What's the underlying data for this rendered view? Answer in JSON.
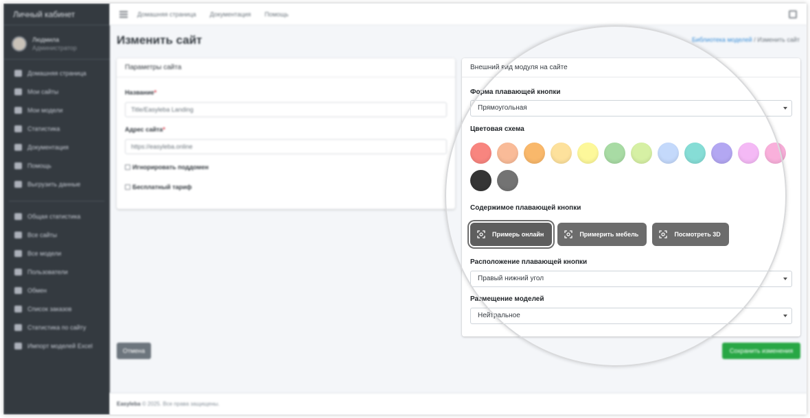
{
  "sidebar": {
    "brand": "Личный кабинет",
    "user_name": "Людмила",
    "user_role": "Администратор",
    "items_main": [
      "Домашняя страница",
      "Мои сайты",
      "Мои модели",
      "Статистика",
      "Документация",
      "Помощь",
      "Выгрузить данные"
    ],
    "items_admin": [
      "Общая статистика",
      "Все сайты",
      "Все модели",
      "Пользователи",
      "Обмен",
      "Список заказов",
      "Статистика по сайту",
      "Импорт моделей Excel"
    ]
  },
  "topbar": {
    "links": [
      "Домашняя страница",
      "Документация",
      "Помощь"
    ]
  },
  "header": {
    "title": "Изменить сайт",
    "breadcrumb_link": "Библиотека моделей",
    "breadcrumb_sep": "/",
    "breadcrumb_current": "Изменить сайт"
  },
  "params_card": {
    "title": "Параметры сайта",
    "name_label": "Название",
    "name_value": "Title/Easyleba Landing",
    "address_label": "Адрес сайта",
    "address_value": "https://easyleba.online",
    "required_mark": "*",
    "checkbox_ignore": "Игнорировать поддомен",
    "checkbox_free": "Бесплатный тариф"
  },
  "appearance_card": {
    "title": "Внешний вид модуля на сайте",
    "shape_label": "Форма плавающей кнопки",
    "shape_value": "Прямоугольная",
    "color_label": "Цветовая схема",
    "colors": [
      "#f8857f",
      "#f9bb98",
      "#f9b86b",
      "#fde19c",
      "#fdf89a",
      "#a8dba4",
      "#d6f0a4",
      "#c4d9fb",
      "#86ddd6",
      "#b3a7f2",
      "#f4b9f5",
      "#f9b0db",
      "#353535",
      "#737373"
    ],
    "content_label": "Содержимое плавающей кнопки",
    "buttons": [
      "Примерь онлайн",
      "Примерить мебель",
      "Посмотреть 3D"
    ],
    "position_label": "Расположение плавающей кнопки",
    "position_value": "Правый нижний угол",
    "placement_label": "Размещение моделей",
    "placement_value": "Нейтральное"
  },
  "actions": {
    "cancel": "Отмена",
    "save": "Сохранить изменения"
  },
  "footer": {
    "brand": "Easyleba",
    "text": "© 2025. Все права защищены."
  }
}
